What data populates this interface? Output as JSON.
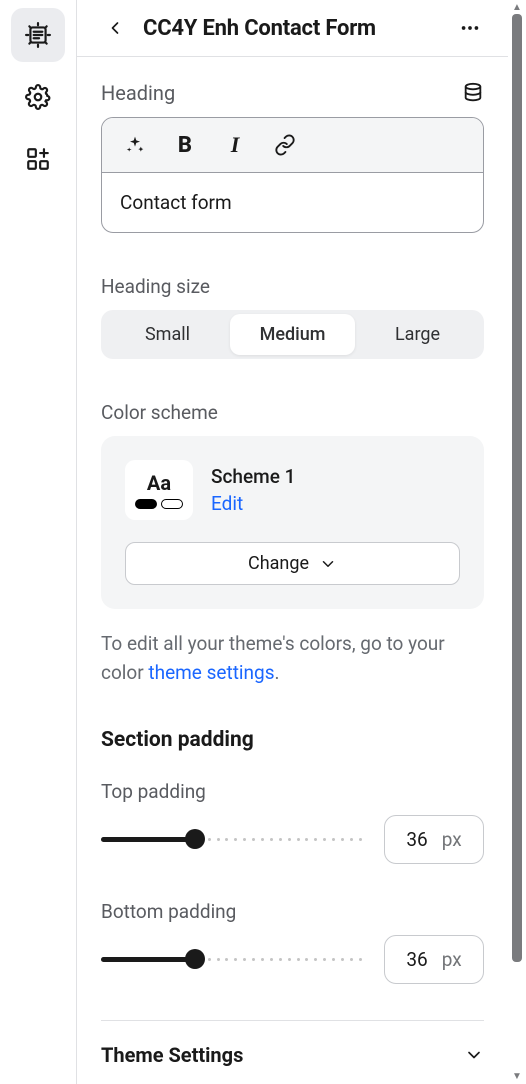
{
  "header": {
    "title": "CC4Y Enh Contact Form"
  },
  "heading": {
    "label": "Heading",
    "value": "Contact form"
  },
  "heading_size": {
    "label": "Heading size",
    "options": [
      "Small",
      "Medium",
      "Large"
    ],
    "selected": "Medium"
  },
  "color_scheme": {
    "label": "Color scheme",
    "swatch_text": "Aa",
    "scheme_name": "Scheme 1",
    "edit_label": "Edit",
    "change_label": "Change",
    "hint_prefix": "To edit all your theme's colors, go to your color ",
    "hint_link": "theme settings",
    "hint_suffix": "."
  },
  "section_padding": {
    "title": "Section padding",
    "top": {
      "label": "Top padding",
      "value": "36",
      "unit": "px",
      "percent": 36
    },
    "bottom": {
      "label": "Bottom padding",
      "value": "36",
      "unit": "px",
      "percent": 36
    }
  },
  "theme_settings": {
    "title": "Theme Settings"
  }
}
